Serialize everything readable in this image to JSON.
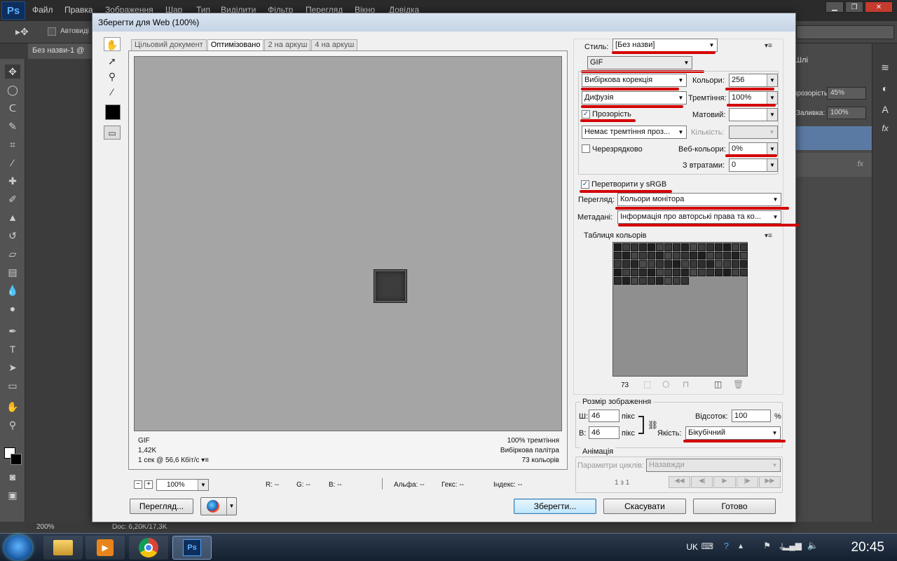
{
  "ps": {
    "logo": "Ps",
    "menu": [
      "Файл",
      "Правка",
      "Зображення",
      "Шар",
      "Тип",
      "Виділити",
      "Фільтр",
      "Перегляд",
      "Вікно",
      "Довідка"
    ],
    "autoselect": "Автовиді",
    "doc_tab": "Без назви-1 @",
    "opacity_label": "прозорість:",
    "opacity_value": "45%",
    "fill_label": "Заливка:",
    "fill_value": "100%",
    "layers_tab": "Шлі",
    "status_zoom": "200%",
    "status_doc": "Doc: 6,20K/17,3K"
  },
  "dialog": {
    "title": "Зберегти для Web (100%)",
    "tabs": [
      "Цільовий документ",
      "Оптимізовано",
      "2 на аркуш",
      "4 на аркуш"
    ],
    "preview_info_left": [
      "GIF",
      "1,42K",
      "1 сек @ 56,6 Кбіт/с"
    ],
    "preview_info_right": [
      "100% тремтіння",
      "Вибіркова палітра",
      "73 кольорів"
    ],
    "zoom": "100%",
    "readouts": {
      "r": "R: --",
      "g": "G: --",
      "b": "B: --",
      "alpha": "Альфа: --",
      "hex": "Гекс: --",
      "index": "Індекс: --"
    },
    "buttons": {
      "preview": "Перегляд...",
      "save": "Зберегти...",
      "cancel": "Скасувати",
      "done": "Готово"
    }
  },
  "settings": {
    "style_label": "Стиль:",
    "style_value": "[Без назви]",
    "format": "GIF",
    "reduction": "Вибіркова корекція",
    "colors_label": "Кольори:",
    "colors_value": "256",
    "dither_algo": "Дифузія",
    "dither_label": "Тремтіння:",
    "dither_value": "100%",
    "transparency_label": "Прозорість",
    "transparency_checked": "✓",
    "matte_label": "Матовий:",
    "trans_dither": "Немає тремтіння проз...",
    "amount_label": "Кількість:",
    "interlaced_label": "Черезрядково",
    "web_colors_label": "Веб-кольори:",
    "web_colors_value": "0%",
    "lossy_label": "З втратами:",
    "lossy_value": "0",
    "srgb_label": "Перетворити у sRGB",
    "srgb_checked": "✓",
    "preview_label": "Перегляд:",
    "preview_value": "Кольори монітора",
    "metadata_label": "Метадані:",
    "metadata_value": "Інформація про авторські права та ко...",
    "color_table_title": "Таблиця кольорів",
    "color_count": "73",
    "image_size_title": "Розмір зображення",
    "width_label": "Ш:",
    "width_value": "46",
    "height_label": "В:",
    "height_value": "46",
    "unit": "пікс",
    "percent_label": "Відсоток:",
    "percent_value": "100",
    "percent_sign": "%",
    "quality_label": "Якість:",
    "quality_value": "Бікубічний",
    "animation_title": "Анімація",
    "loop_label": "Параметри циклів:",
    "loop_value": "Назавжди",
    "frame_counter": "1 з 1"
  },
  "taskbar": {
    "lang": "UK",
    "time": "20:45"
  }
}
